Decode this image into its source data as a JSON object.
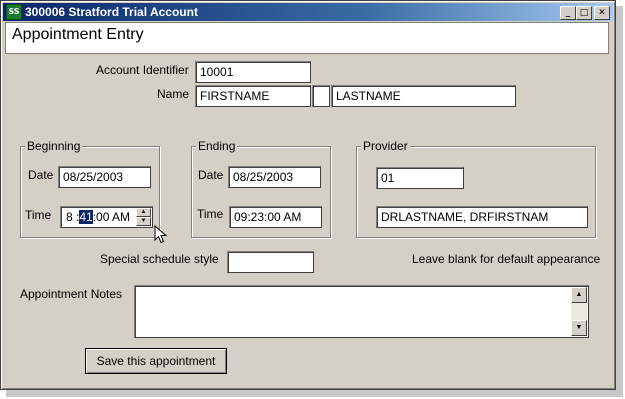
{
  "window": {
    "title": "300006 Stratford Trial Account",
    "icon_text": "SS",
    "controls": {
      "minimize": "_",
      "maximize": "□",
      "close": "✕"
    }
  },
  "header": {
    "title": "Appointment Entry"
  },
  "account": {
    "label": "Account Identifier",
    "value": "10001"
  },
  "name": {
    "label": "Name",
    "first": "FIRSTNAME",
    "middle": "",
    "last": "LASTNAME"
  },
  "beginning": {
    "group_label": "Beginning",
    "date_label": "Date",
    "date_value": "08/25/2003",
    "time_label": "Time",
    "time_hour": "8 :",
    "time_minute_selected": "41",
    "time_rest": ":00 AM"
  },
  "ending": {
    "group_label": "Ending",
    "date_label": "Date",
    "date_value": "08/25/2003",
    "time_label": "Time",
    "time_value": "09:23:00 AM"
  },
  "provider": {
    "group_label": "Provider",
    "code": "01",
    "name": "DRLASTNAME, DRFIRSTNAM"
  },
  "schedule_style": {
    "label": "Special schedule style",
    "value": "",
    "hint": "Leave blank for default appearance"
  },
  "notes": {
    "label": "Appointment Notes",
    "value": ""
  },
  "save_button": {
    "label": "Save this appointment"
  },
  "icons": {
    "spin_up": "▲",
    "spin_down": "▼",
    "scroll_up": "▲",
    "scroll_down": "▼"
  }
}
